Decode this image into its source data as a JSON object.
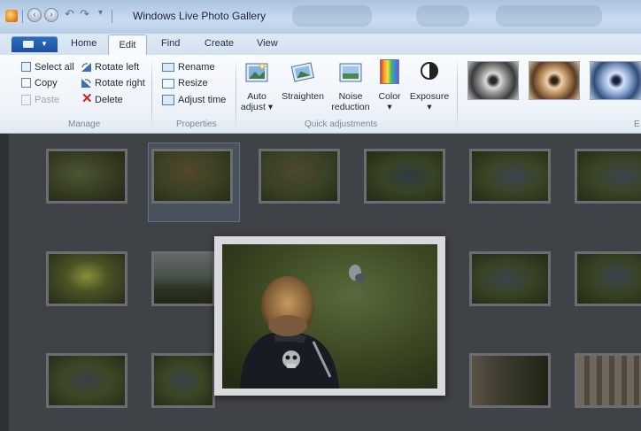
{
  "window": {
    "title": "Windows Live Photo Gallery"
  },
  "tabs": [
    {
      "label": "Home"
    },
    {
      "label": "Edit"
    },
    {
      "label": "Find"
    },
    {
      "label": "Create"
    },
    {
      "label": "View"
    }
  ],
  "ribbon": {
    "manage": {
      "select_all": "Select all",
      "copy": "Copy",
      "paste": "Paste",
      "rotate_left": "Rotate left",
      "rotate_right": "Rotate right",
      "delete": "Delete",
      "label": "Manage"
    },
    "properties": {
      "rename": "Rename",
      "resize": "Resize",
      "adjust_time": "Adjust time",
      "label": "Properties"
    },
    "quick": {
      "auto_adjust_1": "Auto",
      "auto_adjust_2": "adjust ▾",
      "straighten": "Straighten",
      "noise_1": "Noise",
      "noise_2": "reduction",
      "color": "Color",
      "exposure": "Exposure",
      "dropdown_mark": "▾",
      "label": "Quick adjustments"
    },
    "effects": {
      "label": "E"
    }
  },
  "colors": {
    "accent": "#1b4f9c",
    "gallery_bg": "#3f4247"
  }
}
